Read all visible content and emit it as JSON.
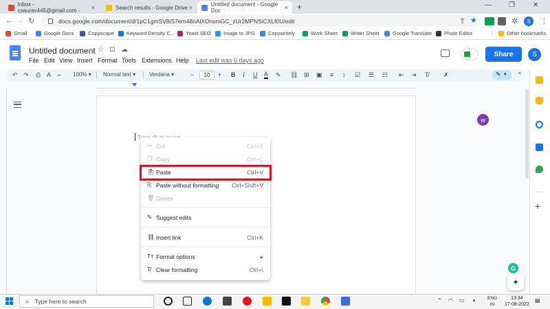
{
  "browser": {
    "tabs": [
      {
        "label": "Inbox - csaurav445@gmail.com -",
        "active": false,
        "icon": "gmail-icon"
      },
      {
        "label": "Search results - Google Drive",
        "active": false,
        "icon": "drive-icon"
      },
      {
        "label": "Untitled document - Google Doc",
        "active": true,
        "icon": "docs-icon"
      }
    ],
    "new_tab": "+",
    "url": "docs.google.com/document/d/1pC1gmSV8iS7em48nAlXOnsmGC_zUr2MPNSiCXLf0U/edit",
    "bookmarks": [
      {
        "label": "Gmail",
        "color": "#ea4335"
      },
      {
        "label": "Google Docs",
        "color": "#4285f4"
      },
      {
        "label": "Copyscape",
        "color": "#3d5c99"
      },
      {
        "label": "Keyword Density C...",
        "color": "#1a73e8"
      },
      {
        "label": "Yoast SEO",
        "color": "#a4286a"
      },
      {
        "label": "Image to JPG",
        "color": "#2196f3"
      },
      {
        "label": "Copywritely",
        "color": "#3b82f6"
      },
      {
        "label": "Work Sheet",
        "color": "#0f9d58"
      },
      {
        "label": "Writer Sheet",
        "color": "#0f9d58"
      },
      {
        "label": "Google Translate",
        "color": "#4285f4"
      },
      {
        "label": "Photo Editor",
        "color": "#333333"
      }
    ],
    "other_bookmarks": "Other bookmarks",
    "profile_initial": "S"
  },
  "docs": {
    "title": "Untitled document",
    "menus": [
      "File",
      "Edit",
      "View",
      "Insert",
      "Format",
      "Tools",
      "Extensions",
      "Help"
    ],
    "last_edit": "Last edit was 6 days ago",
    "share_label": "Share",
    "avatar_initial": "S",
    "toolbar": {
      "zoom": "100%",
      "style": "Normal text",
      "font": "Verdana",
      "font_size": "10"
    },
    "placeholder": "Type @ to insert",
    "extension_badge": "w"
  },
  "context_menu": {
    "items": [
      {
        "label": "Cut",
        "shortcut": "Ctrl+X",
        "enabled": false,
        "icon": "scissors-icon"
      },
      {
        "label": "Copy",
        "shortcut": "Ctrl+C",
        "enabled": false,
        "icon": "copy-icon"
      },
      {
        "label": "Paste",
        "shortcut": "Ctrl+V",
        "enabled": true,
        "icon": "paste-icon",
        "highlighted": true
      },
      {
        "label": "Paste without formatting",
        "shortcut": "Ctrl+Shift+V",
        "enabled": true,
        "icon": "paste-plain-icon"
      },
      {
        "label": "Delete",
        "shortcut": "",
        "enabled": false,
        "icon": "trash-icon"
      },
      {
        "label": "Suggest edits",
        "shortcut": "",
        "enabled": true,
        "icon": "suggest-edit-icon"
      },
      {
        "label": "Insert link",
        "shortcut": "Ctrl+K",
        "enabled": true,
        "icon": "link-icon"
      },
      {
        "label": "Format options",
        "shortcut": "▸",
        "enabled": true,
        "icon": "text-format-icon"
      },
      {
        "label": "Clear formatting",
        "shortcut": "Ctrl+\\",
        "enabled": true,
        "icon": "clear-format-icon"
      }
    ],
    "highlight_color": "#e0131f"
  },
  "taskbar": {
    "search_placeholder": "Type here to search",
    "language": "ENG",
    "region": "IN",
    "time": "13:34",
    "date": "17-08-2022"
  },
  "grammarly_letter": "G",
  "colors": {
    "share_blue": "#1a73e8",
    "docs_blue": "#4285f4"
  }
}
